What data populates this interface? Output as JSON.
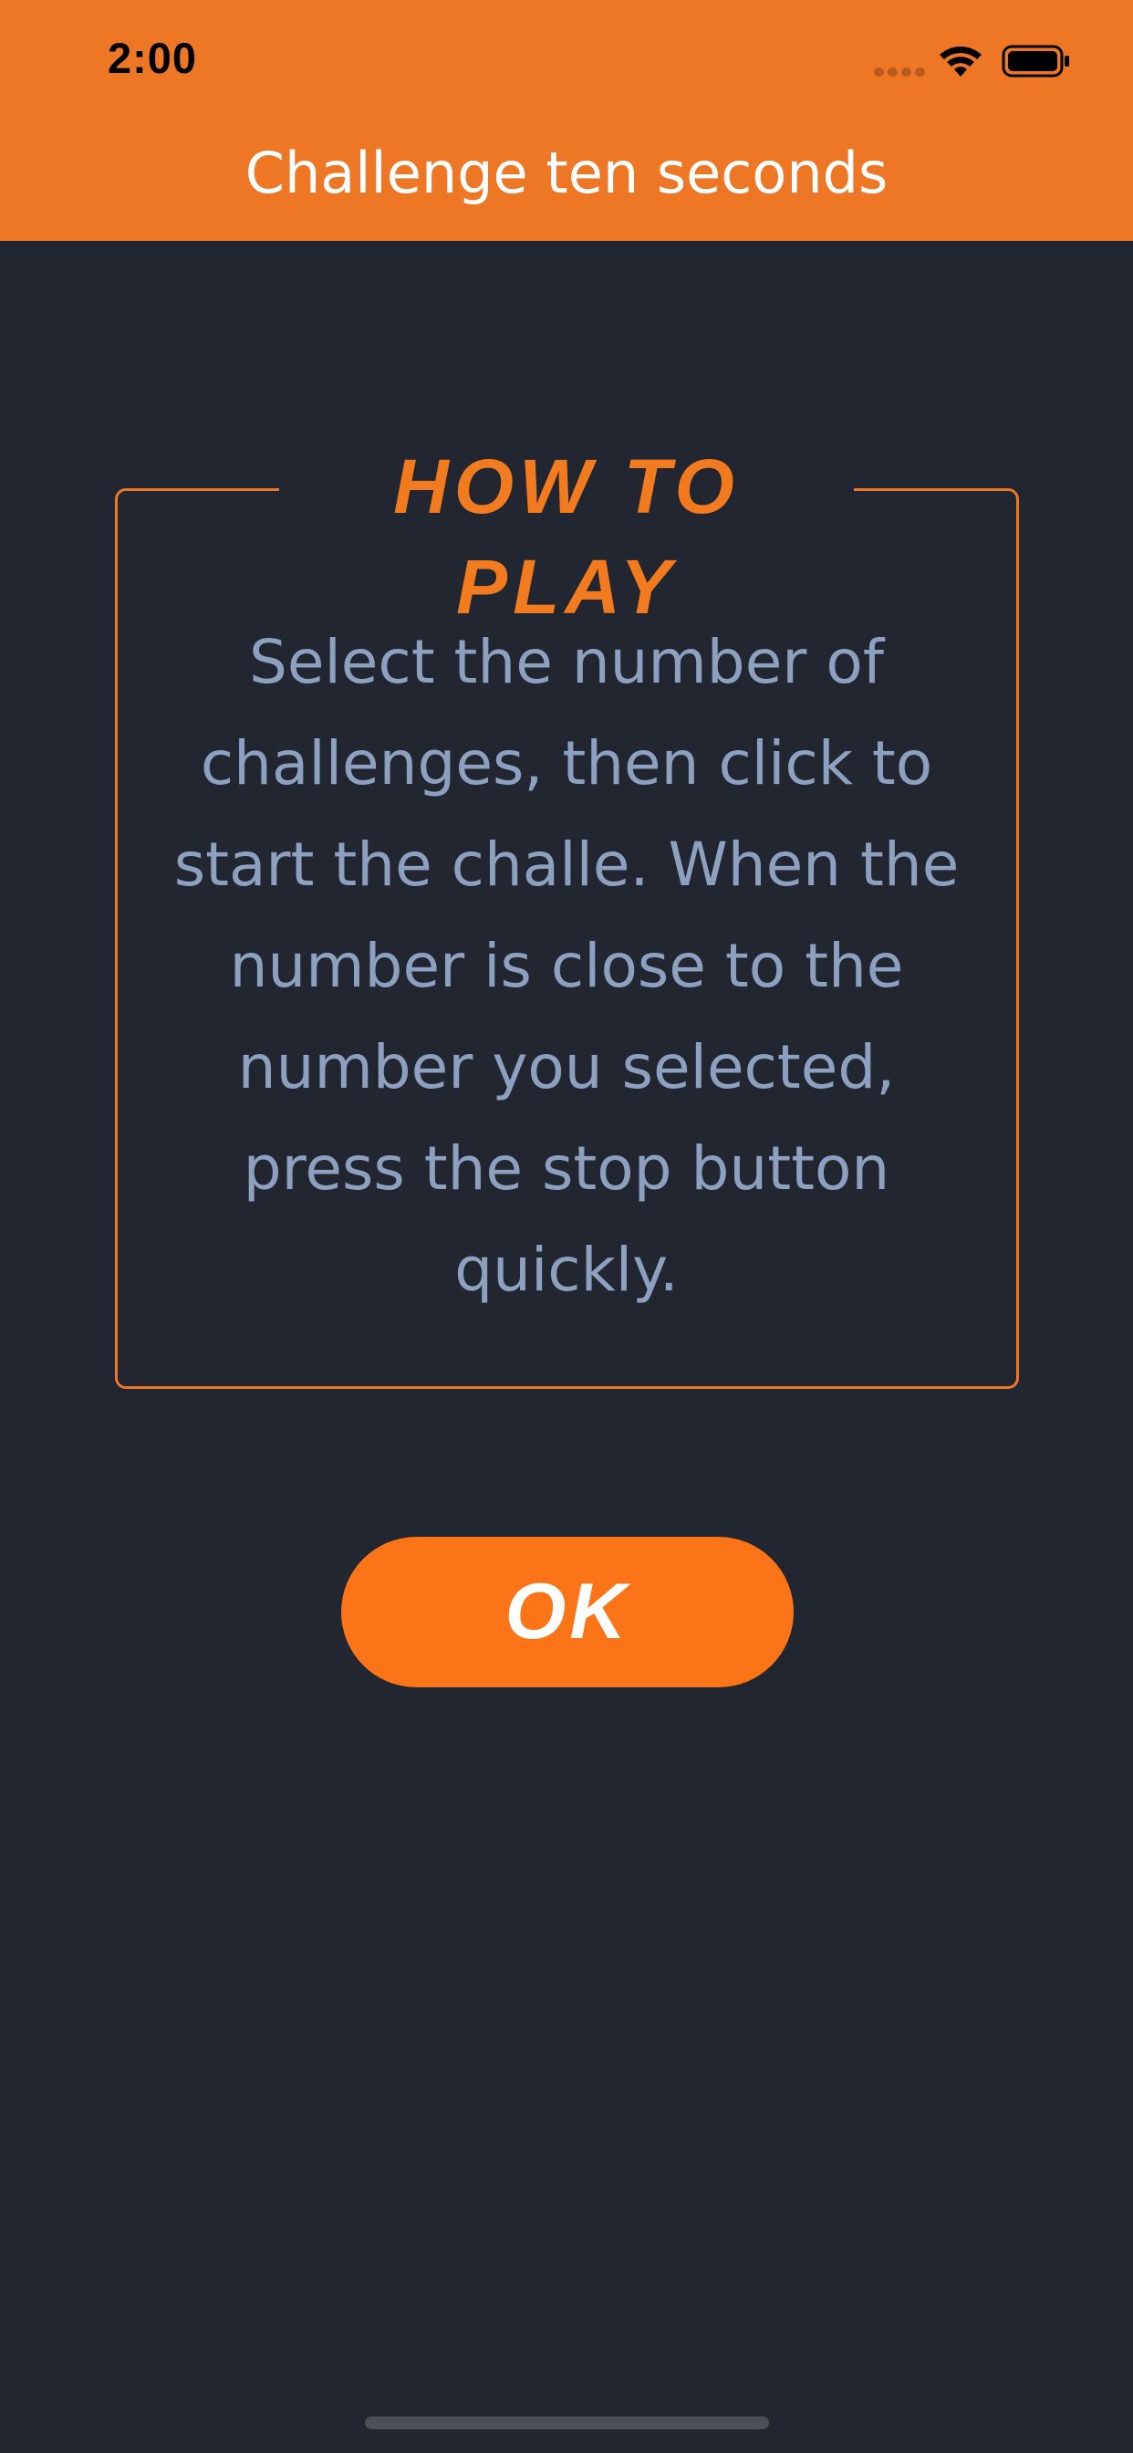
{
  "status_bar": {
    "time": "2:00",
    "signal_icon": "cellular-signal-icon",
    "wifi_icon": "wifi-icon",
    "battery_icon": "battery-icon"
  },
  "header": {
    "title": "Challenge ten seconds",
    "background_color": "#EE7726"
  },
  "instructions": {
    "title": "HOW TO PLAY",
    "body": "Select the number of challenges, then click to start the challe. When the number is close to the number you selected, press the stop button quickly."
  },
  "actions": {
    "ok_label": "OK"
  },
  "colors": {
    "background": "#212630",
    "accent": "#EE7726",
    "button": "#FB7418",
    "body_text": "#8EA0BF"
  }
}
